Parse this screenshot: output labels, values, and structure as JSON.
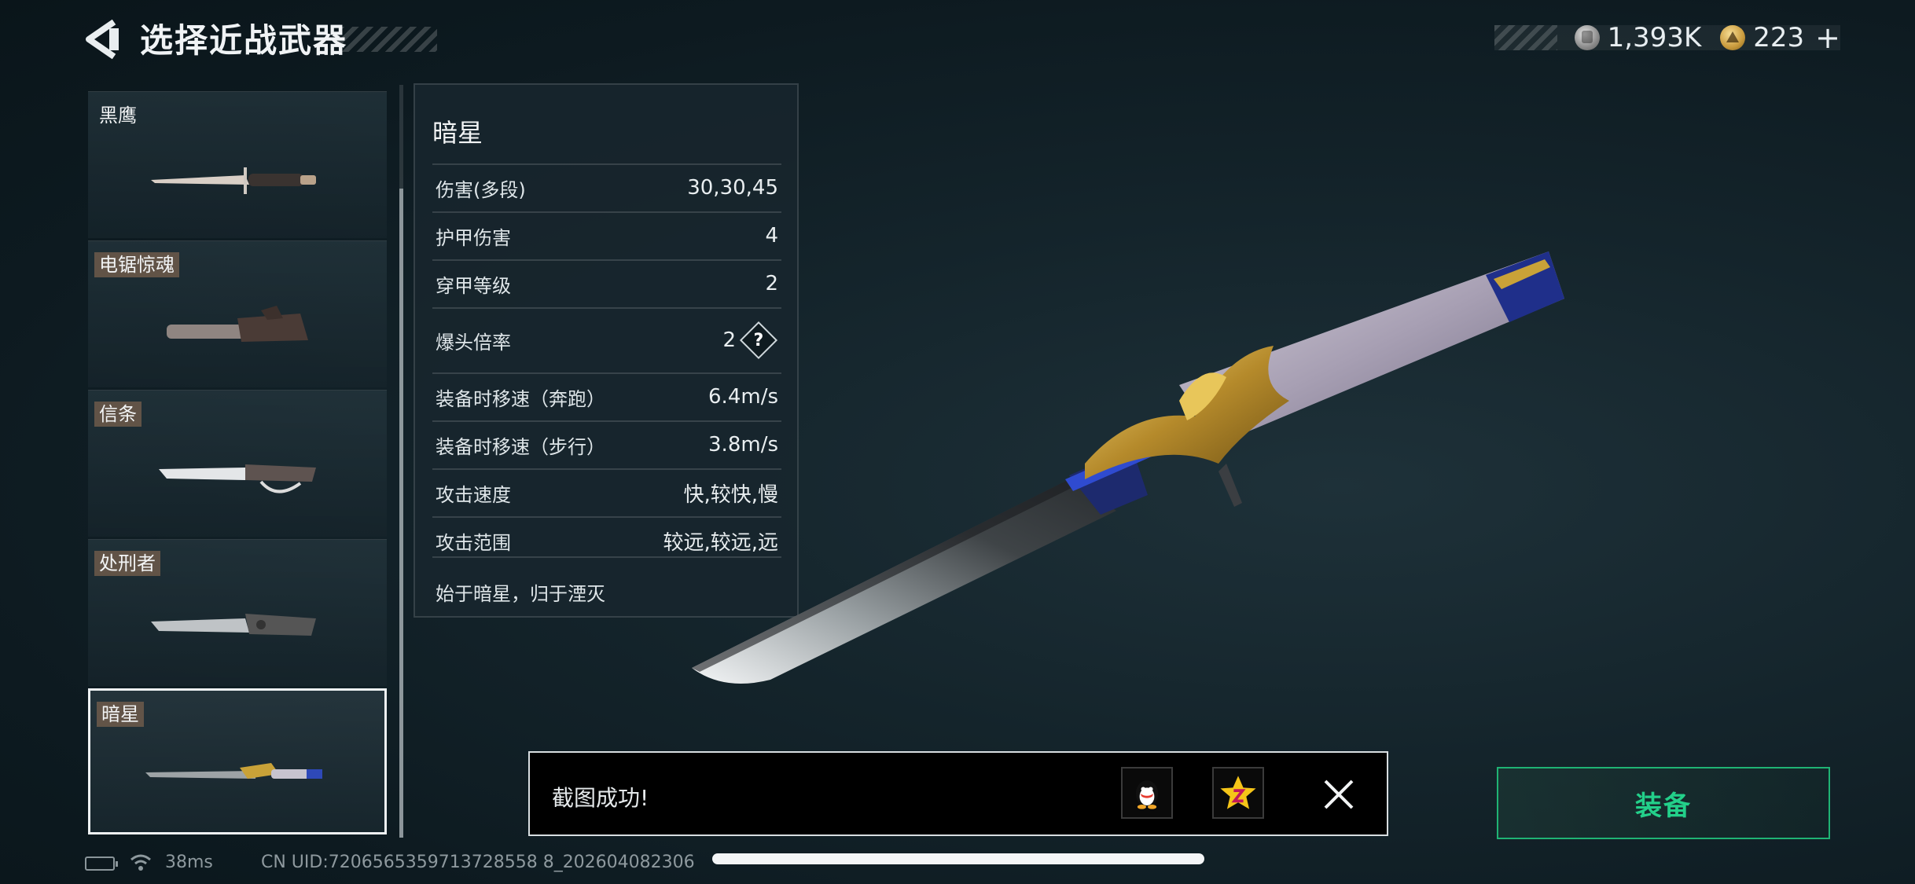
{
  "header": {
    "title": "选择近战武器",
    "currency": [
      {
        "icon": "silver-coin-icon",
        "value": "1,393K"
      },
      {
        "icon": "gold-coin-icon",
        "value": "223"
      }
    ],
    "add_symbol": "+"
  },
  "weapon_list": {
    "items": [
      {
        "name": "黑鹰",
        "selected": false
      },
      {
        "name": "电锯惊魂",
        "selected": false
      },
      {
        "name": "信条",
        "selected": false
      },
      {
        "name": "处刑者",
        "selected": false
      },
      {
        "name": "暗星",
        "selected": true
      }
    ]
  },
  "stats": {
    "title": "暗星",
    "rows": [
      {
        "label": "伤害(多段)",
        "value": "30,30,45"
      },
      {
        "label": "护甲伤害",
        "value": "4"
      },
      {
        "label": "穿甲等级",
        "value": "2"
      },
      {
        "label": "爆头倍率",
        "value": "2",
        "help": "?"
      },
      {
        "label": "装备时移速（奔跑）",
        "value": "6.4m/s"
      },
      {
        "label": "装备时移速（步行）",
        "value": "3.8m/s"
      },
      {
        "label": "攻击速度",
        "value": "快,较快,慢"
      },
      {
        "label": "攻击范围",
        "value": "较远,较远,远"
      }
    ],
    "description": "始于暗星，归于湮灭"
  },
  "toast": {
    "message": "截图成功!",
    "share": [
      "qq-icon",
      "qzone-icon"
    ]
  },
  "equip_button": {
    "label": "装备"
  },
  "footer": {
    "ping": "38ms",
    "uid": "CN UID:7206565359713728558 8_202604082306"
  },
  "colors": {
    "accent_green": "#23d08a",
    "background": "#14242b"
  }
}
